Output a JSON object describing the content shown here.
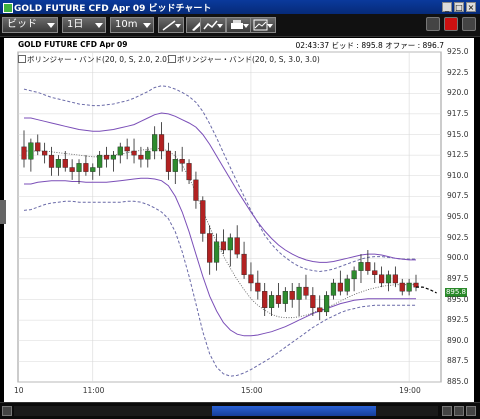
{
  "window": {
    "title": "GOLD FUTURE CFD Apr 09 ビッドチャート"
  },
  "toolbar": {
    "price_type": "ビッド",
    "period": "1日",
    "interval": "10m"
  },
  "header": {
    "instrument": "GOLD FUTURE CFD Apr 09",
    "time": "02:43:37",
    "bid_label": "ビッド :",
    "bid_value": "895.8",
    "offer_label": "オファー :",
    "offer_value": "896.7"
  },
  "legend": [
    {
      "label": "ボリンジャー・バンド(20, 0, S, 2.0, 2.0)"
    },
    {
      "label": "ボリンジャー・バンド(20, 0, S, 3.0, 3.0)"
    }
  ],
  "current_price_label": "895.8",
  "colors": {
    "up": "#2e8b2e",
    "down": "#b22222",
    "band2": "#7b4fb8",
    "band3": "#6a6aa8",
    "mid": "#555555",
    "accent": "#1f4fb8"
  },
  "chart_data": {
    "type": "candlestick",
    "x_ticks": [
      "10",
      "11:00",
      "15:00",
      "19:00"
    ],
    "y_ticks": [
      "925.0",
      "922.5",
      "920.0",
      "917.5",
      "915.0",
      "912.5",
      "910.0",
      "907.5",
      "905.0",
      "902.5",
      "900.0",
      "897.5",
      "895.0",
      "892.5",
      "890.0",
      "887.5",
      "885.0"
    ],
    "ylim": [
      885.0,
      925.0
    ],
    "grid": true,
    "candles": [
      [
        913.5,
        915.5,
        911.0,
        912.0
      ],
      [
        912.0,
        914.5,
        910.5,
        914.0
      ],
      [
        914.0,
        915.0,
        912.5,
        913.0
      ],
      [
        913.0,
        914.0,
        911.5,
        912.5
      ],
      [
        912.5,
        913.5,
        910.0,
        911.0
      ],
      [
        911.0,
        912.5,
        910.0,
        912.0
      ],
      [
        912.0,
        913.0,
        910.5,
        911.0
      ],
      [
        911.0,
        912.0,
        909.5,
        910.5
      ],
      [
        910.5,
        912.0,
        909.0,
        911.5
      ],
      [
        911.5,
        912.5,
        910.0,
        910.5
      ],
      [
        910.5,
        911.5,
        909.5,
        911.0
      ],
      [
        911.0,
        913.0,
        910.0,
        912.5
      ],
      [
        912.5,
        913.5,
        911.0,
        912.0
      ],
      [
        912.0,
        913.0,
        910.5,
        912.5
      ],
      [
        912.5,
        914.0,
        911.5,
        913.5
      ],
      [
        913.5,
        914.5,
        912.0,
        913.0
      ],
      [
        913.0,
        914.5,
        911.5,
        912.5
      ],
      [
        912.5,
        913.5,
        911.0,
        912.0
      ],
      [
        912.0,
        913.5,
        911.0,
        913.0
      ],
      [
        913.0,
        916.0,
        912.0,
        915.0
      ],
      [
        915.0,
        916.5,
        912.0,
        913.0
      ],
      [
        913.0,
        914.0,
        909.5,
        910.5
      ],
      [
        910.5,
        913.0,
        909.0,
        912.0
      ],
      [
        912.0,
        913.5,
        910.5,
        911.5
      ],
      [
        911.5,
        912.0,
        909.0,
        909.5
      ],
      [
        909.5,
        910.5,
        906.0,
        907.0
      ],
      [
        907.0,
        907.5,
        902.0,
        903.0
      ],
      [
        903.0,
        904.0,
        898.0,
        899.5
      ],
      [
        899.5,
        903.0,
        898.5,
        902.0
      ],
      [
        902.0,
        903.5,
        900.5,
        901.0
      ],
      [
        901.0,
        903.0,
        899.0,
        902.5
      ],
      [
        902.5,
        904.0,
        900.0,
        900.5
      ],
      [
        900.5,
        902.0,
        897.5,
        898.0
      ],
      [
        898.0,
        899.5,
        896.0,
        897.0
      ],
      [
        897.0,
        898.5,
        895.0,
        896.0
      ],
      [
        896.0,
        897.0,
        893.0,
        894.0
      ],
      [
        894.0,
        896.0,
        893.0,
        895.5
      ],
      [
        895.5,
        897.0,
        894.0,
        894.5
      ],
      [
        894.5,
        896.5,
        893.5,
        896.0
      ],
      [
        896.0,
        897.0,
        894.0,
        895.0
      ],
      [
        895.0,
        897.0,
        893.0,
        896.5
      ],
      [
        896.5,
        898.0,
        895.0,
        895.5
      ],
      [
        895.5,
        896.5,
        893.0,
        894.0
      ],
      [
        894.0,
        895.5,
        892.5,
        893.5
      ],
      [
        893.5,
        896.0,
        893.0,
        895.5
      ],
      [
        895.5,
        897.5,
        895.0,
        897.0
      ],
      [
        897.0,
        898.5,
        895.5,
        896.0
      ],
      [
        896.0,
        898.0,
        895.5,
        897.5
      ],
      [
        897.5,
        899.0,
        896.0,
        898.5
      ],
      [
        898.5,
        900.5,
        897.0,
        899.5
      ],
      [
        899.5,
        901.0,
        898.0,
        898.5
      ],
      [
        898.5,
        899.5,
        897.0,
        898.0
      ],
      [
        898.0,
        899.0,
        896.5,
        897.0
      ],
      [
        897.0,
        898.5,
        896.0,
        898.0
      ],
      [
        898.0,
        899.0,
        896.5,
        897.0
      ],
      [
        897.0,
        897.5,
        895.5,
        896.0
      ],
      [
        896.0,
        897.5,
        895.5,
        897.0
      ],
      [
        897.0,
        898.0,
        896.0,
        896.5
      ]
    ],
    "forecast_tail": [
      [
        896.5
      ],
      [
        896.2
      ],
      [
        895.8
      ]
    ],
    "band2_upper": [
      917.0,
      917.0,
      916.8,
      916.6,
      916.4,
      916.2,
      916.0,
      915.8,
      915.6,
      915.5,
      915.4,
      915.4,
      915.5,
      915.6,
      915.8,
      916.0,
      916.2,
      916.6,
      917.0,
      917.4,
      917.6,
      917.5,
      917.2,
      916.8,
      916.4,
      915.9,
      915.0,
      913.8,
      912.4,
      911.0,
      909.6,
      908.2,
      906.9,
      905.6,
      904.4,
      903.3,
      902.4,
      901.6,
      901.0,
      900.5,
      900.1,
      899.8,
      899.6,
      899.5,
      899.5,
      899.6,
      899.8,
      900.0,
      900.2,
      900.4,
      900.5,
      900.5,
      900.4,
      900.2,
      900.0,
      899.9,
      899.8,
      899.8
    ],
    "band2_lower": [
      909.0,
      909.0,
      909.2,
      909.3,
      909.4,
      909.4,
      909.4,
      909.3,
      909.3,
      909.2,
      909.2,
      909.2,
      909.2,
      909.3,
      909.4,
      909.5,
      909.6,
      909.7,
      909.7,
      909.6,
      909.4,
      908.8,
      907.5,
      905.6,
      903.2,
      900.5,
      897.8,
      895.4,
      893.6,
      892.2,
      891.3,
      890.8,
      890.6,
      890.6,
      890.7,
      890.9,
      891.1,
      891.4,
      891.7,
      892.1,
      892.5,
      892.9,
      893.3,
      893.6,
      893.9,
      894.2,
      894.5,
      894.7,
      894.9,
      895.0,
      895.1,
      895.1,
      895.1,
      895.1,
      895.1,
      895.1,
      895.1,
      895.1
    ],
    "band3_upper": [
      920.5,
      920.3,
      920.1,
      919.8,
      919.5,
      919.3,
      919.1,
      918.9,
      918.7,
      918.6,
      918.5,
      918.5,
      918.6,
      918.7,
      918.9,
      919.1,
      919.4,
      919.8,
      920.2,
      920.7,
      920.9,
      920.8,
      920.5,
      920.1,
      919.6,
      918.9,
      917.8,
      916.3,
      914.6,
      912.8,
      911.0,
      909.2,
      907.5,
      905.8,
      904.3,
      902.8,
      901.7,
      900.8,
      900.1,
      899.5,
      899.0,
      898.7,
      898.5,
      898.4,
      898.5,
      898.7,
      899.0,
      899.3,
      899.6,
      899.9,
      900.1,
      900.2,
      900.2,
      900.1,
      900.0,
      899.9,
      899.9,
      899.9
    ],
    "band3_lower": [
      905.8,
      905.9,
      906.2,
      906.5,
      906.7,
      906.8,
      906.9,
      906.9,
      906.8,
      906.8,
      906.8,
      906.8,
      906.8,
      906.8,
      906.8,
      906.9,
      906.9,
      906.8,
      906.5,
      906.1,
      905.6,
      904.8,
      903.2,
      900.8,
      897.8,
      894.5,
      891.1,
      888.4,
      886.8,
      886.0,
      885.7,
      885.8,
      886.1,
      886.5,
      887.0,
      887.5,
      888.0,
      888.6,
      889.2,
      889.8,
      890.4,
      891.0,
      891.6,
      892.1,
      892.6,
      893.0,
      893.4,
      893.7,
      893.9,
      894.1,
      894.2,
      894.3,
      894.3,
      894.3,
      894.3,
      894.3,
      894.3,
      894.3
    ],
    "middle": [
      913.0,
      913.0,
      913.0,
      913.0,
      912.9,
      912.8,
      912.7,
      912.6,
      912.5,
      912.4,
      912.3,
      912.3,
      912.4,
      912.5,
      912.6,
      912.8,
      912.9,
      913.1,
      913.2,
      913.3,
      913.3,
      913.0,
      912.4,
      911.3,
      909.8,
      907.9,
      905.8,
      903.8,
      902.0,
      900.3,
      898.8,
      897.4,
      896.2,
      895.1,
      894.3,
      893.7,
      893.2,
      892.9,
      892.8,
      892.8,
      892.9,
      893.1,
      893.4,
      893.7,
      894.0,
      894.4,
      894.8,
      895.2,
      895.6,
      895.9,
      896.2,
      896.4,
      896.6,
      896.7,
      896.8,
      896.8,
      896.8,
      896.8
    ]
  }
}
